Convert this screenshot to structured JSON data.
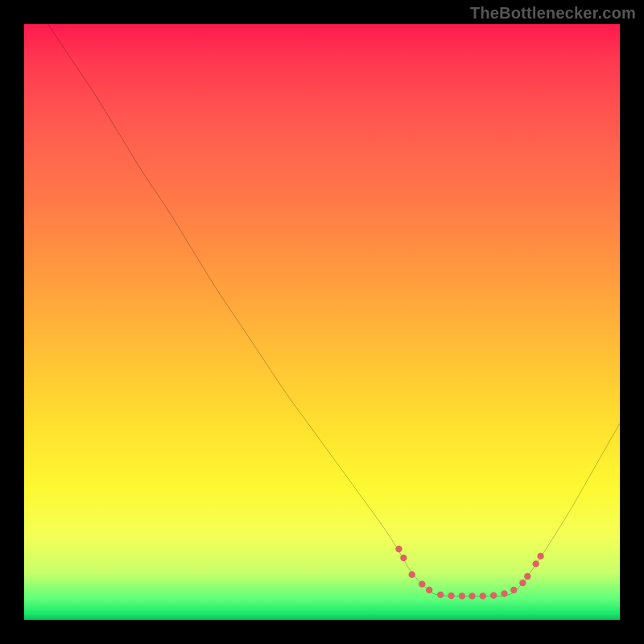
{
  "attribution": "TheBottlenecker.com",
  "colors": {
    "frame_background": "#000000",
    "curve_stroke": "#000000",
    "marker_fill": "#dd6262",
    "gradient_top": "#ff1a4e",
    "gradient_bottom": "#0fbf57"
  },
  "chart_data": {
    "type": "line",
    "title": "",
    "xlabel": "",
    "ylabel": "",
    "xlim": [
      0,
      100
    ],
    "ylim": [
      0,
      100
    ],
    "note": "Y is inverted (0 at top, 100 at bottom) to match on-screen orientation; lower on screen = closer to green band (better).",
    "series": [
      {
        "name": "bottleneck_curve",
        "x": [
          4.0,
          8.0,
          12.0,
          16.0,
          20.0,
          24.0,
          28.0,
          32.0,
          36.0,
          40.0,
          44.0,
          48.0,
          52.0,
          56.0,
          60.0,
          62.0,
          63.5,
          65.0,
          67.0,
          69.0,
          72.0,
          76.0,
          80.0,
          82.0,
          83.5,
          85.0,
          88.0,
          92.0,
          96.0,
          100.0
        ],
        "y": [
          0.0,
          6.0,
          12.0,
          18.5,
          25.0,
          31.0,
          37.5,
          44.0,
          50.0,
          56.0,
          62.0,
          67.5,
          73.0,
          78.5,
          84.0,
          87.0,
          89.5,
          92.0,
          94.2,
          95.7,
          96.0,
          96.0,
          96.0,
          95.5,
          94.0,
          92.0,
          87.5,
          81.0,
          74.0,
          67.0
        ]
      }
    ],
    "markers": [
      {
        "x": 62.9,
        "y": 88.1
      },
      {
        "x": 63.7,
        "y": 89.6
      },
      {
        "x": 65.1,
        "y": 92.4
      },
      {
        "x": 66.8,
        "y": 94.0
      },
      {
        "x": 68.0,
        "y": 95.0
      },
      {
        "x": 69.9,
        "y": 95.8
      },
      {
        "x": 71.7,
        "y": 95.95
      },
      {
        "x": 73.5,
        "y": 96.0
      },
      {
        "x": 75.2,
        "y": 96.0
      },
      {
        "x": 77.0,
        "y": 96.0
      },
      {
        "x": 78.8,
        "y": 95.9
      },
      {
        "x": 80.6,
        "y": 95.6
      },
      {
        "x": 82.2,
        "y": 95.0
      },
      {
        "x": 83.7,
        "y": 93.8
      },
      {
        "x": 84.5,
        "y": 92.7
      },
      {
        "x": 85.9,
        "y": 90.6
      },
      {
        "x": 86.7,
        "y": 89.3
      }
    ],
    "marker_radius_px": 4.2
  }
}
